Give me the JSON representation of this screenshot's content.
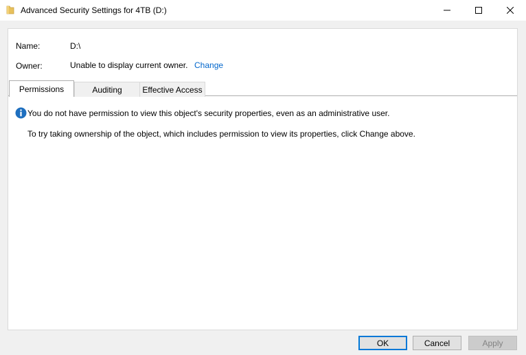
{
  "window": {
    "title": "Advanced Security Settings for 4TB (D:)",
    "icon": "folder-icon",
    "controls": [
      "minimize-icon",
      "maximize-icon",
      "close-icon"
    ]
  },
  "info": {
    "name_label": "Name:",
    "name_value": "D:\\",
    "owner_label": "Owner:",
    "owner_value": "Unable to display current owner.",
    "owner_change_link": "Change"
  },
  "tabs": [
    {
      "label": "Permissions",
      "selected": true
    },
    {
      "label": "Auditing",
      "selected": false
    },
    {
      "label": "Effective Access",
      "selected": false
    }
  ],
  "content": {
    "icon": "info-icon",
    "message": "You do not have permission to view this object's security properties, even as an administrative user.",
    "hint": "To try taking ownership of the object, which includes permission to view its properties, click Change above."
  },
  "buttons": {
    "ok": "OK",
    "cancel": "Cancel",
    "apply": "Apply"
  },
  "colors": {
    "link": "#0066cc",
    "info_icon": "#1e6fbf",
    "focus_border": "#0078d7",
    "folder": "#e8c15c"
  }
}
